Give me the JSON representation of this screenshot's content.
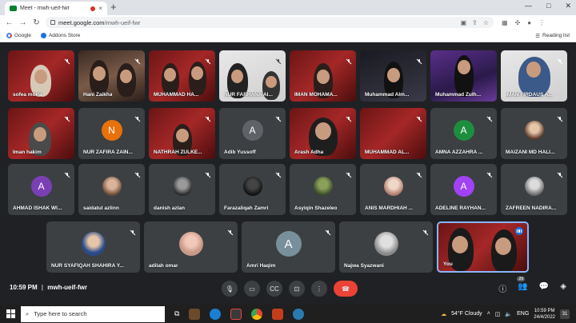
{
  "browser": {
    "tab_title": "Meet - mwh-ueif-fwr",
    "tab_close": "×",
    "new_tab": "+",
    "url_host": "meet.google.com",
    "url_path": "/mwh-ueif-fwr",
    "window_controls": [
      "—",
      "□",
      "✕"
    ],
    "bookmarks": [
      "Google",
      "Addons Store"
    ],
    "reading_list": "Reading list"
  },
  "tiles": [
    {
      "name": "sofea moira"
    },
    {
      "name": "Hani Zaikha"
    },
    {
      "name": "MUHAMMAD HA..."
    },
    {
      "name": "NUR FARHANA AI..."
    },
    {
      "name": "IMAN MOHAMA..."
    },
    {
      "name": "Muhammad Alm..."
    },
    {
      "name": "Muhammad Zulh..."
    },
    {
      "name": "IMAN FIRDAUS A..."
    },
    {
      "name": "Iman hakim"
    },
    {
      "name": "NUR ZAFIRA ZAIN...",
      "initial": "N",
      "color": "#e8710a"
    },
    {
      "name": "NATHRAH ZULKE..."
    },
    {
      "name": "Adib Yussoff",
      "initial": "A",
      "color": "#5f6368"
    },
    {
      "name": "Arash Adha"
    },
    {
      "name": "MUHAMMAD AL..."
    },
    {
      "name": "AMNA AZZAHRA ...",
      "initial": "A",
      "color": "#1e8e3e"
    },
    {
      "name": "MAIZANI MD HALI..."
    },
    {
      "name": "AHMAD ISHAK WI...",
      "initial": "A",
      "color": "#7b3fb5"
    },
    {
      "name": "saidatul azlinn"
    },
    {
      "name": "danish azlan"
    },
    {
      "name": "Farazaliqah Zamri"
    },
    {
      "name": "Asyiqin Shazeleo"
    },
    {
      "name": "ANIS MARDHIAH ..."
    },
    {
      "name": "ADELINE RAYHAN...",
      "initial": "A",
      "color": "#a142f4"
    },
    {
      "name": "ZAFREEN NADIRA..."
    },
    {
      "name": "NUR SYAFIQAH SHAHIRA Y..."
    },
    {
      "name": "adilah omar"
    },
    {
      "name": "Amri Haqim",
      "initial": "A",
      "color": "#78909c"
    },
    {
      "name": "Najwa Syazwani"
    },
    {
      "name": "You"
    }
  ],
  "meeting": {
    "time": "10:59 PM",
    "separator": "|",
    "code": "mwh-ueif-fwr",
    "people_count": "29"
  },
  "taskbar": {
    "search_placeholder": "Type here to search",
    "weather": "54°F  Cloudy",
    "lang": "ENG",
    "clock_time": "10:59 PM",
    "clock_date": "24/4/2022",
    "notifications": "31"
  }
}
